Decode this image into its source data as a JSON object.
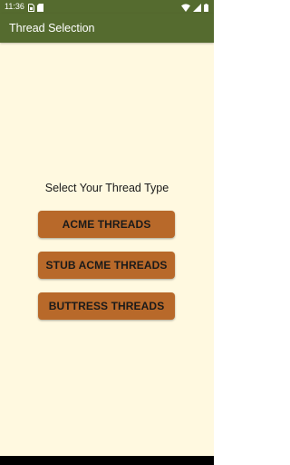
{
  "status_bar": {
    "time": "11:36",
    "background": "#556B2F",
    "icons_left": [
      "sim-card-icon",
      "sd-card-icon"
    ],
    "icons_right": [
      "wifi-icon",
      "signal-icon",
      "battery-icon"
    ]
  },
  "app_bar": {
    "title": "Thread Selection",
    "background": "#556B2F"
  },
  "main": {
    "prompt": "Select Your Thread Type",
    "background": "#FFF9E0",
    "button_color": "#B8692A",
    "buttons": [
      {
        "label": "ACME THREADS"
      },
      {
        "label": "STUB ACME THREADS"
      },
      {
        "label": "BUTTRESS THREADS"
      }
    ]
  }
}
